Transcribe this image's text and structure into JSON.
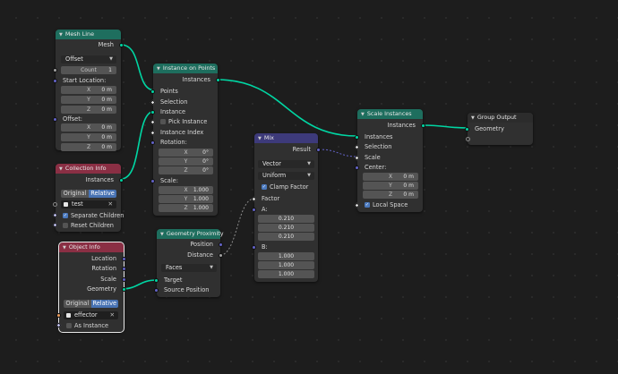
{
  "nodes": {
    "mesh_line": {
      "title": "Mesh Line",
      "out_mesh": "Mesh",
      "mode": "Offset",
      "count_label": "Count",
      "count_value": "1",
      "start_location_label": "Start Location:",
      "start": [
        {
          "k": "X",
          "v": "0 m"
        },
        {
          "k": "Y",
          "v": "0 m"
        },
        {
          "k": "Z",
          "v": "0 m"
        }
      ],
      "offset_label": "Offset:",
      "offset": [
        {
          "k": "X",
          "v": "0 m"
        },
        {
          "k": "Y",
          "v": "0 m"
        },
        {
          "k": "Z",
          "v": "0 m"
        }
      ]
    },
    "collection_info": {
      "title": "Collection Info",
      "out_instances": "Instances",
      "seg_original": "Original",
      "seg_relative": "Relative",
      "collection_value": "test",
      "separate_children": "Separate Children",
      "reset_children": "Reset Children"
    },
    "object_info": {
      "title": "Object Info",
      "out_location": "Location",
      "out_rotation": "Rotation",
      "out_scale": "Scale",
      "out_geometry": "Geometry",
      "seg_original": "Original",
      "seg_relative": "Relative",
      "object_value": "effector",
      "as_instance": "As Instance"
    },
    "instance_on_points": {
      "title": "Instance on Points",
      "out_instances": "Instances",
      "points": "Points",
      "selection": "Selection",
      "instance": "Instance",
      "pick_instance": "Pick Instance",
      "instance_index": "Instance Index",
      "rotation_label": "Rotation:",
      "rotation": [
        {
          "k": "X",
          "v": "0°"
        },
        {
          "k": "Y",
          "v": "0°"
        },
        {
          "k": "Z",
          "v": "0°"
        }
      ],
      "scale_label": "Scale:",
      "scale": [
        {
          "k": "X",
          "v": "1.000"
        },
        {
          "k": "Y",
          "v": "1.000"
        },
        {
          "k": "Z",
          "v": "1.000"
        }
      ]
    },
    "geometry_proximity": {
      "title": "Geometry Proximity",
      "out_position": "Position",
      "out_distance": "Distance",
      "mode": "Faces",
      "target": "Target",
      "source_position": "Source Position"
    },
    "mix": {
      "title": "Mix",
      "out_result": "Result",
      "data_type": "Vector",
      "factor_mode": "Uniform",
      "clamp_factor": "Clamp Factor",
      "factor": "Factor",
      "a_label": "A:",
      "a": [
        "0.210",
        "0.210",
        "0.210"
      ],
      "b_label": "B:",
      "b": [
        "1.000",
        "1.000",
        "1.000"
      ]
    },
    "scale_instances": {
      "title": "Scale Instances",
      "out_instances": "Instances",
      "instances": "Instances",
      "selection": "Selection",
      "scale": "Scale",
      "center_label": "Center:",
      "center": [
        {
          "k": "X",
          "v": "0 m"
        },
        {
          "k": "Y",
          "v": "0 m"
        },
        {
          "k": "Z",
          "v": "0 m"
        }
      ],
      "local_space": "Local Space"
    },
    "group_output": {
      "title": "Group Output",
      "geometry": "Geometry"
    }
  },
  "colors": {
    "geometry_header": "#1e6e5e",
    "input_header": "#8a2f44",
    "converter_header": "#3d3a7a",
    "geometry_socket": "#00d6a3",
    "vector_socket": "#6363c7",
    "wire": "#00d6a3"
  }
}
